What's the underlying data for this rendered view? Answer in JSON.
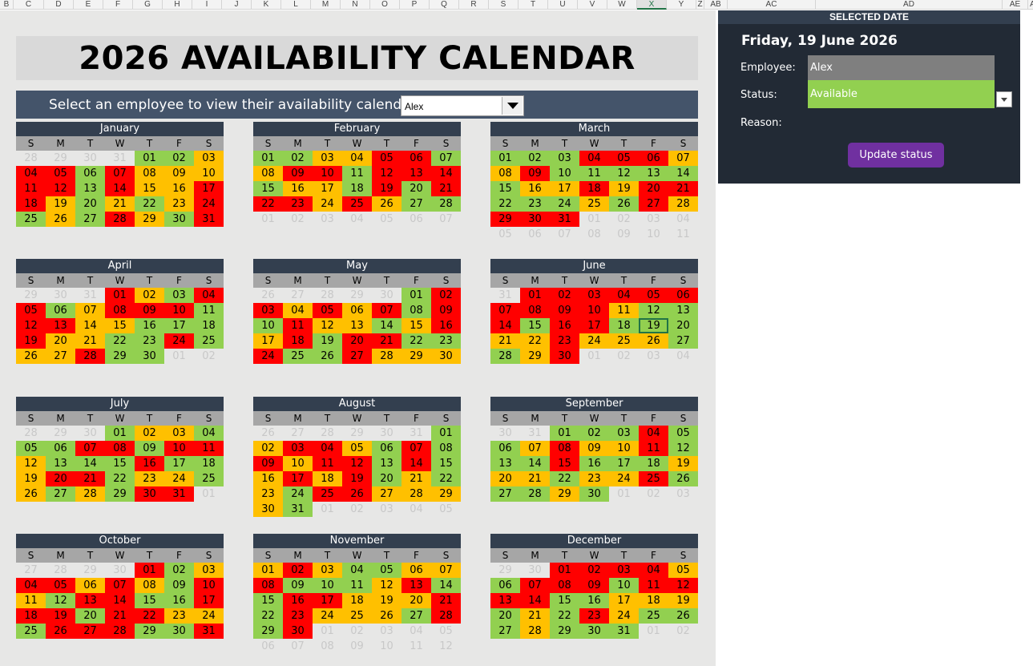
{
  "columns": [
    {
      "label": "B",
      "w": 17
    },
    {
      "label": "C",
      "w": 38
    },
    {
      "label": "D",
      "w": 37
    },
    {
      "label": "E",
      "w": 37
    },
    {
      "label": "F",
      "w": 37
    },
    {
      "label": "G",
      "w": 37
    },
    {
      "label": "H",
      "w": 37
    },
    {
      "label": "I",
      "w": 37
    },
    {
      "label": "J",
      "w": 37
    },
    {
      "label": "K",
      "w": 37
    },
    {
      "label": "L",
      "w": 37
    },
    {
      "label": "M",
      "w": 37
    },
    {
      "label": "N",
      "w": 37
    },
    {
      "label": "O",
      "w": 37
    },
    {
      "label": "P",
      "w": 37
    },
    {
      "label": "Q",
      "w": 37
    },
    {
      "label": "R",
      "w": 37
    },
    {
      "label": "S",
      "w": 37
    },
    {
      "label": "T",
      "w": 37
    },
    {
      "label": "U",
      "w": 37
    },
    {
      "label": "V",
      "w": 37
    },
    {
      "label": "W",
      "w": 37
    },
    {
      "label": "X",
      "w": 37,
      "active": true
    },
    {
      "label": "Y",
      "w": 37
    },
    {
      "label": "Z",
      "w": 10
    },
    {
      "label": "AB",
      "w": 29
    },
    {
      "label": "AC",
      "w": 110
    },
    {
      "label": "AD",
      "w": 233
    },
    {
      "label": "AE",
      "w": 32
    },
    {
      "label": "A",
      "w": 12
    }
  ],
  "title": "2026 AVAILABILITY CALENDAR",
  "select_prompt": "Select an employee to view their availability calendar:",
  "selected_employee": "Alex",
  "dow": [
    "S",
    "M",
    "T",
    "W",
    "T",
    "F",
    "S"
  ],
  "legend_colors": {
    "available": "#92d050",
    "unavailable": "#ff0000",
    "partial": "#ffc000"
  },
  "months": [
    {
      "name": "January",
      "weeks": [
        "o28 o29 o30 o31 a01 a02 c03",
        "b04 b05 a06 b07 c08 c09 c10",
        "b11 b12 a13 b14 c15 c16 b17",
        "b18 c19 a20 c21 a22 c23 b24",
        "a25 c26 a27 b28 c29 a30 b31"
      ]
    },
    {
      "name": "February",
      "weeks": [
        "a01 a02 c03 c04 b05 b06 a07",
        "c08 b09 b10 a11 b12 b13 b14",
        "a15 c16 c17 a18 b19 a20 b21",
        "b22 b23 c24 b25 c26 a27 a28",
        "o01 o02 o03 o04 o05 o06 o07"
      ]
    },
    {
      "name": "March",
      "weeks": [
        "a01 a02 a03 b04 b05 b06 c07",
        "c08 b09 a10 a11 a12 a13 a14",
        "a15 c16 c17 b18 c19 b20 b21",
        "a22 a23 a24 c25 a26 b27 c28",
        "b29 b30 b31 o01 o02 o03 o04",
        "o05 o06 o07 o08 o09 o10 o11"
      ]
    },
    {
      "name": "April",
      "weeks": [
        "o29 o30 o31 b01 c02 a03 b04",
        "b05 a06 c07 b08 b09 b10 a11",
        "b12 b13 c14 c15 a16 a17 a18",
        "b19 c20 c21 a22 a23 b24 a25",
        "c26 c27 b28 a29 a30 o01 o02"
      ]
    },
    {
      "name": "May",
      "weeks": [
        "o26 o27 o28 o29 o30 a01 b02",
        "b03 c04 b05 c06 b07 a08 b09",
        "a10 b11 c12 c13 a14 c15 b16",
        "c17 b18 a19 b20 b21 a22 a23",
        "b24 a25 a26 b27 c28 c29 c30"
      ]
    },
    {
      "name": "June",
      "weeks": [
        "o31 b01 b02 b03 b04 b05 b06",
        "b07 b08 b09 b10 c11 a12 a13",
        "b14 a15 b16 b17 a18 a19 a20",
        "c21 c22 b23 c24 c25 c26 a27",
        "a28 c29 b30 o01 o02 o03 o04"
      ]
    },
    {
      "name": "July",
      "weeks": [
        "o28 o29 o30 a01 c02 c03 a04",
        "a05 a06 b07 b08 a09 b10 b11",
        "c12 a13 a14 a15 b16 a17 a18",
        "c19 b20 b21 a22 c23 c24 a25",
        "c26 a27 c28 a29 b30 b31 o01"
      ]
    },
    {
      "name": "August",
      "weeks": [
        "o26 o27 o28 o29 o30 o31 a01",
        "c02 b03 b04 c05 a06 b07 a08",
        "b09 c10 b11 b12 a13 b14 a15",
        "c16 b17 c18 b19 a20 c21 a22",
        "c23 a24 b25 b26 c27 c28 c29",
        "c30 a31 o01 o02 o03 o04 o05"
      ]
    },
    {
      "name": "September",
      "weeks": [
        "o30 o31 a01 a02 a03 b04 a05",
        "a06 c07 b08 c09 c10 b11 a12",
        "a13 a14 b15 a16 a17 a18 c19",
        "c20 c21 a22 c23 c24 b25 a26",
        "a27 a28 c29 a30 o01 o02 o03"
      ]
    },
    {
      "name": "October",
      "weeks": [
        "o27 o28 o29 o30 b01 a02 c03",
        "b04 b05 c06 b07 c08 a09 b10",
        "c11 a12 b13 b14 a15 a16 b17",
        "b18 b19 a20 b21 b22 c23 c24",
        "a25 b26 b27 b28 a29 a30 b31"
      ]
    },
    {
      "name": "November",
      "weeks": [
        "c01 b02 c03 a04 a05 c06 c07",
        "b08 a09 a10 a11 c12 b13 a14",
        "a15 b16 b17 c18 c19 c20 b21",
        "a22 b23 c24 c25 c26 a27 b28",
        "a29 b30 o01 o02 o03 o04 o05",
        "o06 o07 o08 o09 o10 o11 o12"
      ]
    },
    {
      "name": "December",
      "weeks": [
        "o29 o30 b01 b02 b03 b04 c05",
        "a06 b07 b08 b09 a10 b11 b12",
        "b13 b14 a15 a16 c17 c18 c19",
        "a20 c21 a22 b23 c24 a25 a26",
        "a27 c28 a29 a30 a31 o01 o02"
      ]
    }
  ],
  "selected": {
    "month": "June",
    "day": "19"
  },
  "panel": {
    "header": "SELECTED DATE",
    "date": "Friday, 19 June 2026",
    "employee_label": "Employee:",
    "employee_value": "Alex",
    "status_label": "Status:",
    "status_value": "Available",
    "reason_label": "Reason:",
    "button": "Update status"
  }
}
